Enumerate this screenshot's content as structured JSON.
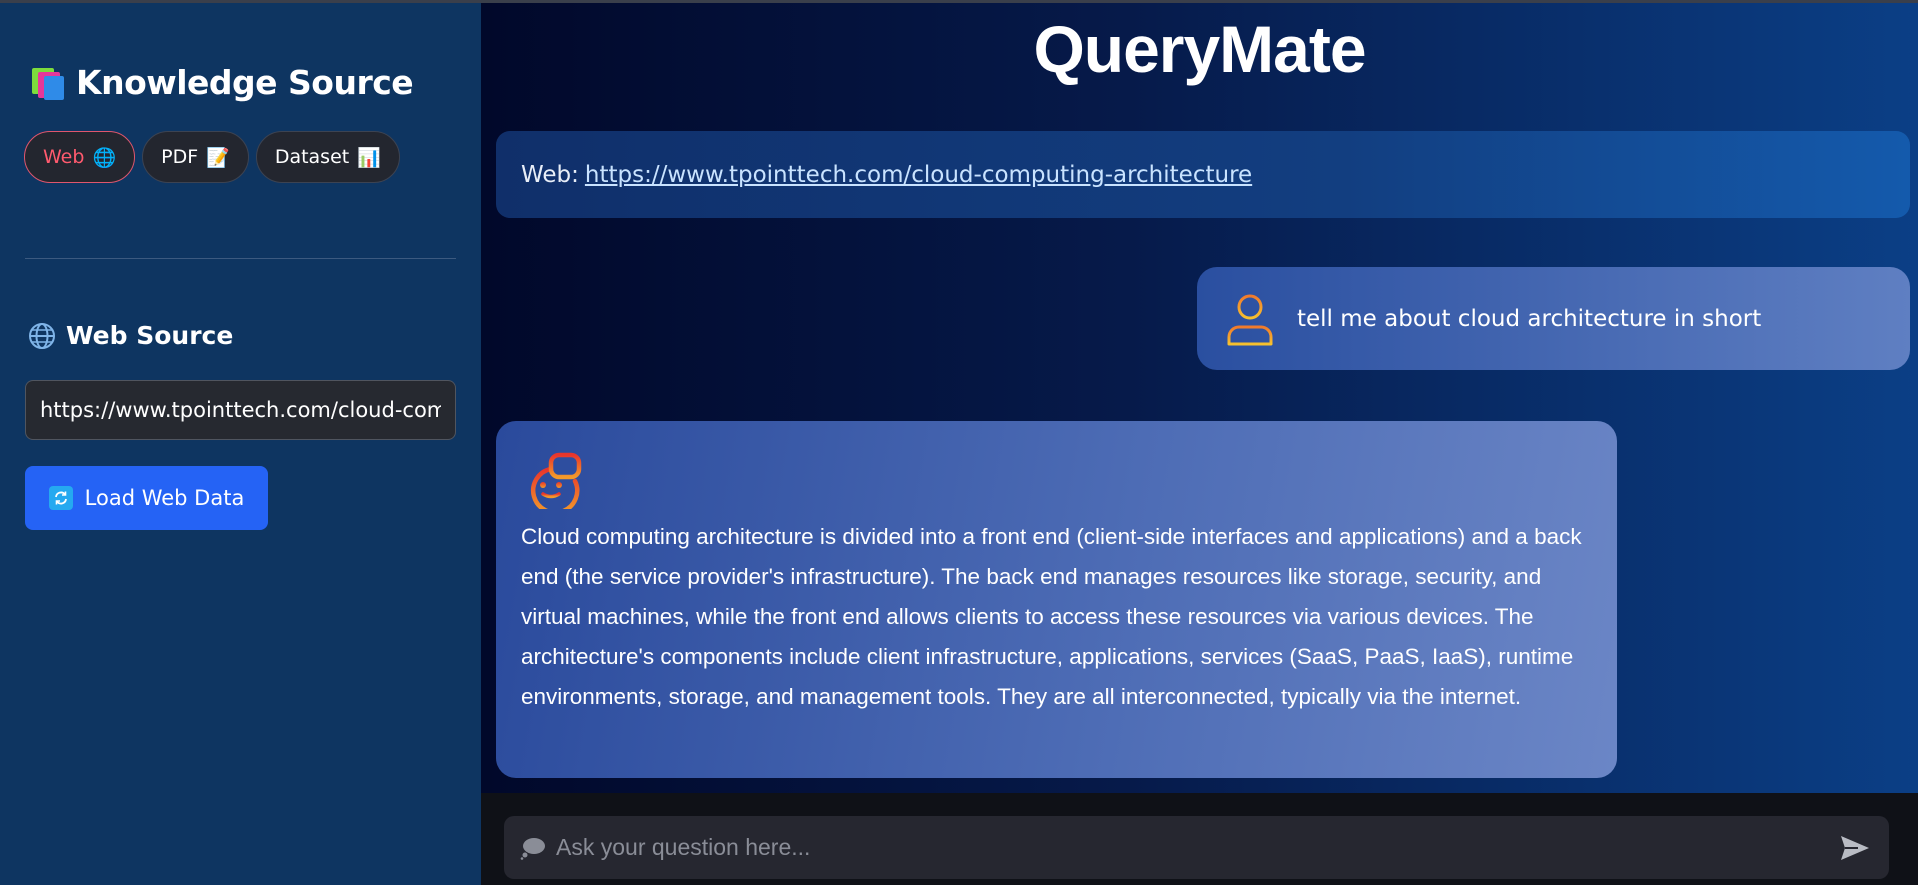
{
  "sidebar": {
    "title": "Knowledge Source",
    "title_icon": "books-icon",
    "tabs": [
      {
        "label": "Web",
        "icon": "globe-icon",
        "glyph": "🌐",
        "active": true
      },
      {
        "label": "PDF",
        "icon": "memo-icon",
        "glyph": "📝",
        "active": false
      },
      {
        "label": "Dataset",
        "icon": "bar-chart-icon",
        "glyph": "📊",
        "active": false
      }
    ],
    "section_title": "Web Source",
    "section_icon": "globe-icon",
    "url_value": "https://www.tpointtech.com/cloud-computing-architecture",
    "load_button_label": "Load Web Data",
    "load_button_icon": "refresh-icon"
  },
  "main": {
    "title": "QueryMate",
    "source_banner": {
      "prefix": "Web:",
      "link": "https://www.tpointtech.com/cloud-computing-architecture"
    },
    "messages": [
      {
        "role": "user",
        "icon": "user-icon",
        "text": "tell me about cloud architecture in short"
      },
      {
        "role": "assistant",
        "icon": "bot-icon",
        "text": "Cloud computing architecture is divided into a front end (client-side interfaces and applications) and a back end (the service provider's infrastructure). The back end manages resources like storage, security, and virtual machines, while the front end allows clients to access these resources via various devices. The architecture's components include client infrastructure, applications, services (SaaS, PaaS, IaaS), runtime environments, storage, and management tools. They are all interconnected, typically via the internet."
      }
    ],
    "chat_input": {
      "placeholder": "Ask your question here...",
      "value": "",
      "icon": "speech-bubble-icon",
      "send_icon": "send-icon"
    }
  },
  "colors": {
    "sidebar_bg": "#0e3561",
    "primary_button": "#2563f5",
    "active_tab": "#ff5a6e",
    "icon_orange": "#f08a2c"
  }
}
